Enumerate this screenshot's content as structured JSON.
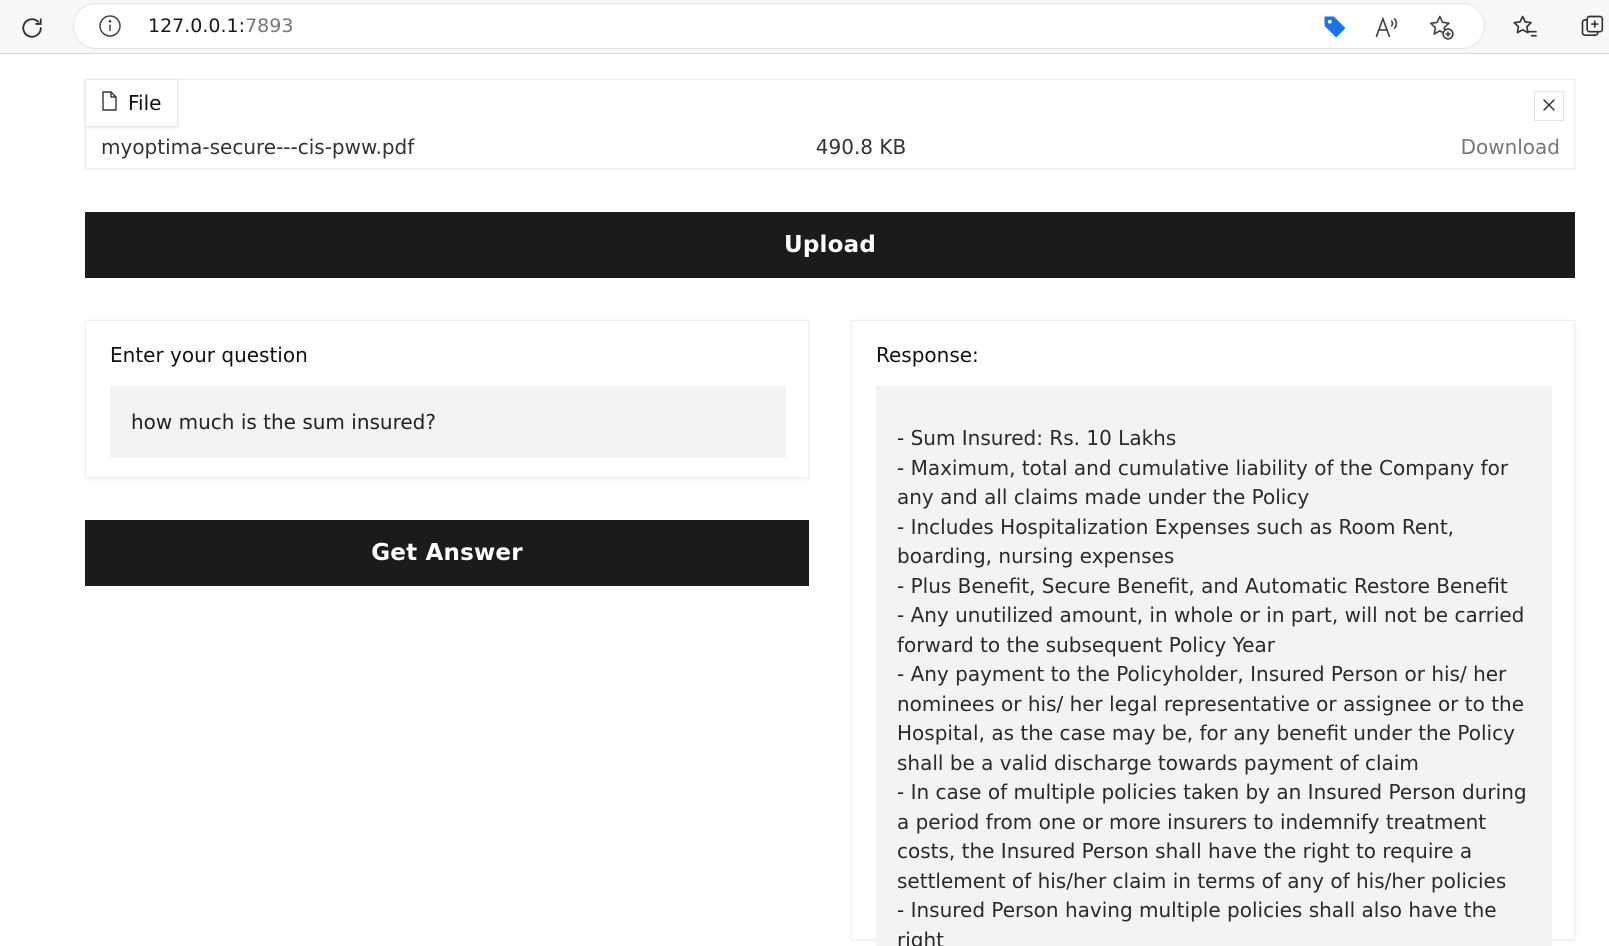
{
  "browser": {
    "url_host": "127.0.0.1:",
    "url_port": "7893",
    "icons": [
      "reload-icon",
      "info-icon",
      "coupon-tag-icon",
      "read-aloud-icon",
      "add-favorite-icon",
      "favorites-icon",
      "collections-icon"
    ]
  },
  "file_panel": {
    "label": "File",
    "file_name": "myoptima-secure---cis-pww.pdf",
    "file_size": "490.8 KB",
    "download_label": "Download"
  },
  "upload_button": {
    "label": "Upload"
  },
  "question": {
    "label": "Enter your question",
    "value": "how much is the sum insured?"
  },
  "answer_button": {
    "label": "Get Answer"
  },
  "response": {
    "label": "Response:",
    "lines": [
      "- Sum Insured: Rs. 10 Lakhs",
      "- Maximum, total and cumulative liability of the Company for any and all claims made under the Policy",
      "- Includes Hospitalization Expenses such as Room Rent, boarding, nursing expenses",
      "- Plus Benefit, Secure Benefit, and Automatic Restore Benefit",
      "- Any unutilized amount, in whole or in part, will not be carried forward to the subsequent Policy Year",
      "- Any payment to the Policyholder, Insured Person or his/ her nominees or his/ her legal representative or assignee or to the Hospital, as the case may be, for any benefit under the Policy shall be a valid discharge towards payment of claim",
      "- In case of multiple policies taken by an Insured Person during a period from one or more insurers to indemnify treatment costs, the Insured Person shall have the right to require a settlement of his/her claim in terms of any of his/her policies",
      "- Insured Person having multiple policies shall also have the right"
    ]
  },
  "colors": {
    "button_bg": "#1b1b1b",
    "input_bg": "#f3f3f3",
    "tag_icon_blue": "#1a73e8"
  }
}
